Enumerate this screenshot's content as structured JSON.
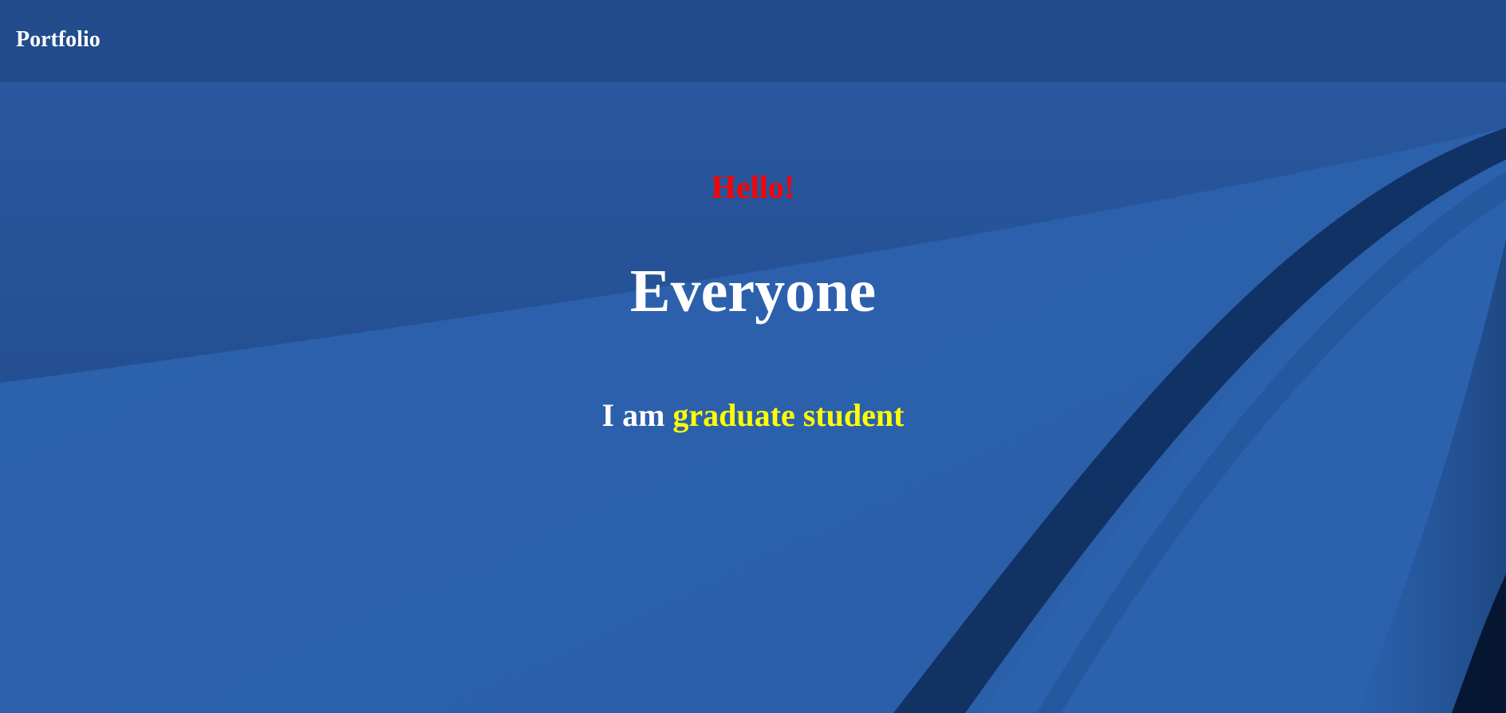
{
  "navbar": {
    "brand": "Portfolio"
  },
  "hero": {
    "greeting": "Hello!",
    "headline": "Everyone",
    "tagline_prefix": "I am",
    "tagline_role": "graduate student"
  },
  "colors": {
    "background": "#2c60ad",
    "navbar": "#22498a",
    "greeting": "#ff0000",
    "headline": "#ffffff",
    "role": "#ffff00"
  }
}
